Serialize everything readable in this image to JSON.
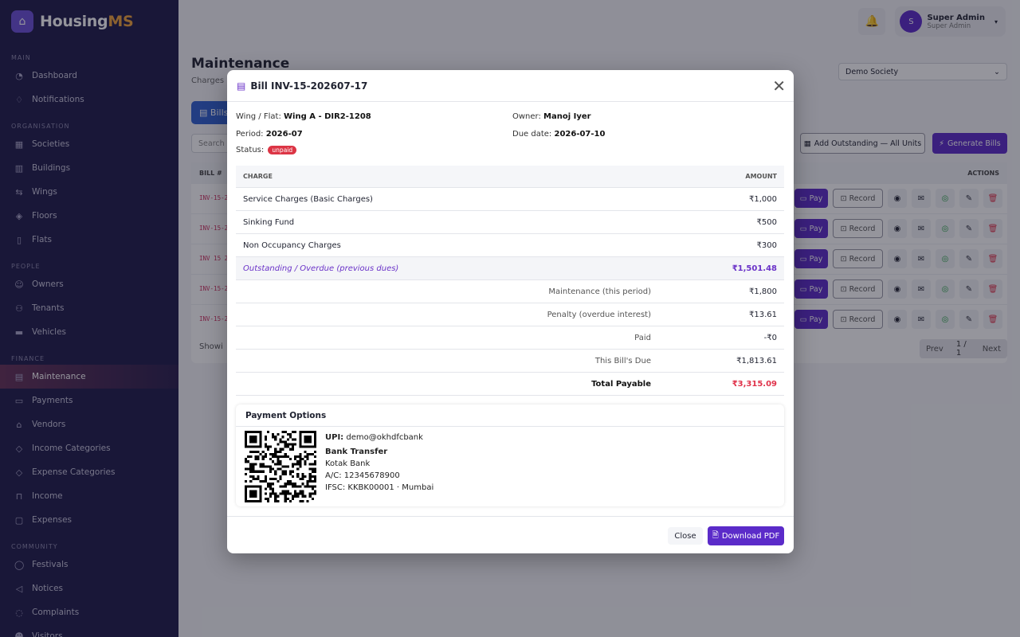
{
  "brand": {
    "name_a": "Housing",
    "name_b": "MS"
  },
  "sidebar": {
    "sections": [
      {
        "label": "MAIN",
        "items": [
          {
            "label": "Dashboard",
            "icon": "dashboard-icon"
          },
          {
            "label": "Notifications",
            "icon": "bell-icon"
          }
        ]
      },
      {
        "label": "ORGANISATION",
        "items": [
          {
            "label": "Societies",
            "icon": "building-icon"
          },
          {
            "label": "Buildings",
            "icon": "buildings-icon"
          },
          {
            "label": "Wings",
            "icon": "signpost-icon"
          },
          {
            "label": "Floors",
            "icon": "layers-icon"
          },
          {
            "label": "Flats",
            "icon": "door-icon"
          }
        ]
      },
      {
        "label": "PEOPLE",
        "items": [
          {
            "label": "Owners",
            "icon": "person-icon"
          },
          {
            "label": "Tenants",
            "icon": "people-icon"
          },
          {
            "label": "Vehicles",
            "icon": "car-icon"
          }
        ]
      },
      {
        "label": "FINANCE",
        "items": [
          {
            "label": "Maintenance",
            "icon": "receipt-icon"
          },
          {
            "label": "Payments",
            "icon": "card-icon"
          },
          {
            "label": "Vendors",
            "icon": "shop-icon"
          },
          {
            "label": "Income Categories",
            "icon": "tag-icon"
          },
          {
            "label": "Expense Categories",
            "icon": "tag-icon"
          },
          {
            "label": "Income",
            "icon": "inbox-icon"
          },
          {
            "label": "Expenses",
            "icon": "wallet-icon"
          }
        ]
      },
      {
        "label": "COMMUNITY",
        "items": [
          {
            "label": "Festivals",
            "icon": "balloon-icon"
          },
          {
            "label": "Notices",
            "icon": "megaphone-icon"
          },
          {
            "label": "Complaints",
            "icon": "alert-icon"
          },
          {
            "label": "Visitors",
            "icon": "visitor-icon"
          }
        ]
      }
    ],
    "active": "Maintenance"
  },
  "topbar": {
    "avatar_letter": "S",
    "user_name": "Super Admin",
    "user_role": "Super Admin"
  },
  "page": {
    "title": "Maintenance",
    "subtitle": "Charges",
    "society_select": "Demo Society",
    "bills_tab": "Bills",
    "search_placeholder": "Search",
    "add_outstanding": "Add Outstanding — All Units",
    "generate_bills": "Generate Bills",
    "table_headers": {
      "bill": "BILL #",
      "actions": "ACTIONS"
    },
    "rows": [
      {
        "bill": "INV-15-2"
      },
      {
        "bill": "INV-15-2"
      },
      {
        "bill": "INV 15 2"
      },
      {
        "bill": "INV-15-2"
      },
      {
        "bill": "INV-15-2"
      }
    ],
    "row_actions": {
      "pay": "Pay",
      "record": "Record"
    },
    "footer_text": "Showi",
    "pager": {
      "prev": "Prev",
      "page": "1 / 1",
      "next": "Next"
    }
  },
  "modal": {
    "title": "Bill INV-15-202607-17",
    "wing_flat_label": "Wing / Flat:",
    "wing_flat": "Wing A - DIR2-1208",
    "owner_label": "Owner:",
    "owner": "Manoj Iyer",
    "period_label": "Period:",
    "period": "2026-07",
    "due_label": "Due date:",
    "due": "2026-07-10",
    "status_label": "Status:",
    "status": "unpaid",
    "charges_header": {
      "charge": "CHARGE",
      "amount": "AMOUNT"
    },
    "charges": [
      {
        "label": "Service Charges (Basic Charges)",
        "amount": "₹1,000"
      },
      {
        "label": "Sinking Fund",
        "amount": "₹500"
      },
      {
        "label": "Non Occupancy Charges",
        "amount": "₹300"
      }
    ],
    "outstanding": {
      "label": "Outstanding / Overdue (previous dues)",
      "amount": "₹1,501.48"
    },
    "summary": [
      {
        "label": "Maintenance (this period)",
        "amount": "₹1,800"
      },
      {
        "label": "Penalty (overdue interest)",
        "amount": "₹13.61"
      },
      {
        "label": "Paid",
        "amount": "-₹0"
      },
      {
        "label": "This Bill's Due",
        "amount": "₹1,813.61"
      }
    ],
    "total": {
      "label": "Total Payable",
      "amount": "₹3,315.09"
    },
    "payment": {
      "title": "Payment Options",
      "upi_label": "UPI:",
      "upi": "demo@okhdfcbank",
      "bank_title": "Bank Transfer",
      "bank_name": "Kotak Bank",
      "account": "A/C: 12345678900",
      "ifsc": "IFSC: KKBK00001 · Mumbai"
    },
    "close": "Close",
    "download": "Download PDF"
  }
}
